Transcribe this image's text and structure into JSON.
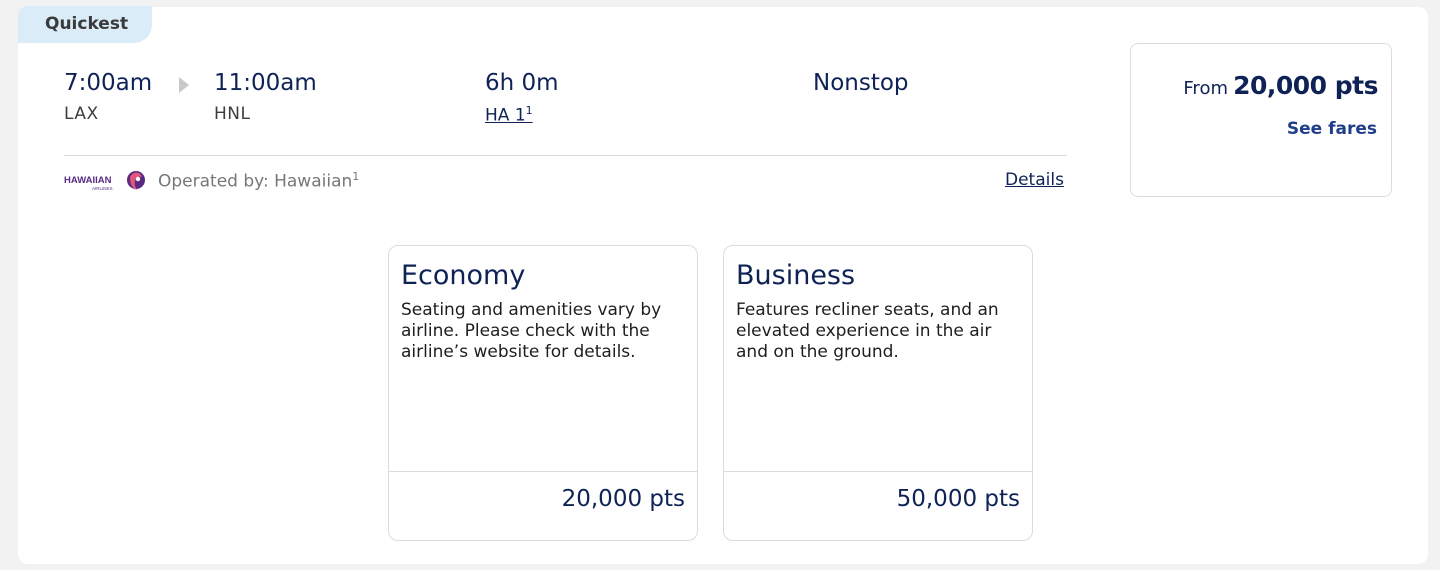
{
  "badge": "Quickest",
  "flight": {
    "depart_time": "7:00am",
    "depart_code": "LAX",
    "arrive_time": "11:00am",
    "arrive_code": "HNL",
    "duration": "6h 0m",
    "flight_number": "HA 1",
    "flight_note": "1",
    "stops": "Nonstop"
  },
  "operator": {
    "logo_text": "HAWAIIAN",
    "logo_subtext": "AIRLINES.",
    "label": "Operated by: Hawaiian",
    "note": "1",
    "details_label": "Details"
  },
  "price_summary": {
    "from_label": "From",
    "points": "20,000 pts",
    "see_fares_label": "See fares"
  },
  "fares": [
    {
      "name": "Economy",
      "description": "Seating and amenities vary by airline. Please check with the airline’s website for details.",
      "price": "20,000 pts"
    },
    {
      "name": "Business",
      "description": "Features recliner seats, and an elevated experience in the air and on the ground.",
      "price": "50,000 pts"
    }
  ],
  "colors": {
    "navy": "#0e2256",
    "badge_bg": "#d9ecf8",
    "logo_purple": "#5a2a83"
  }
}
